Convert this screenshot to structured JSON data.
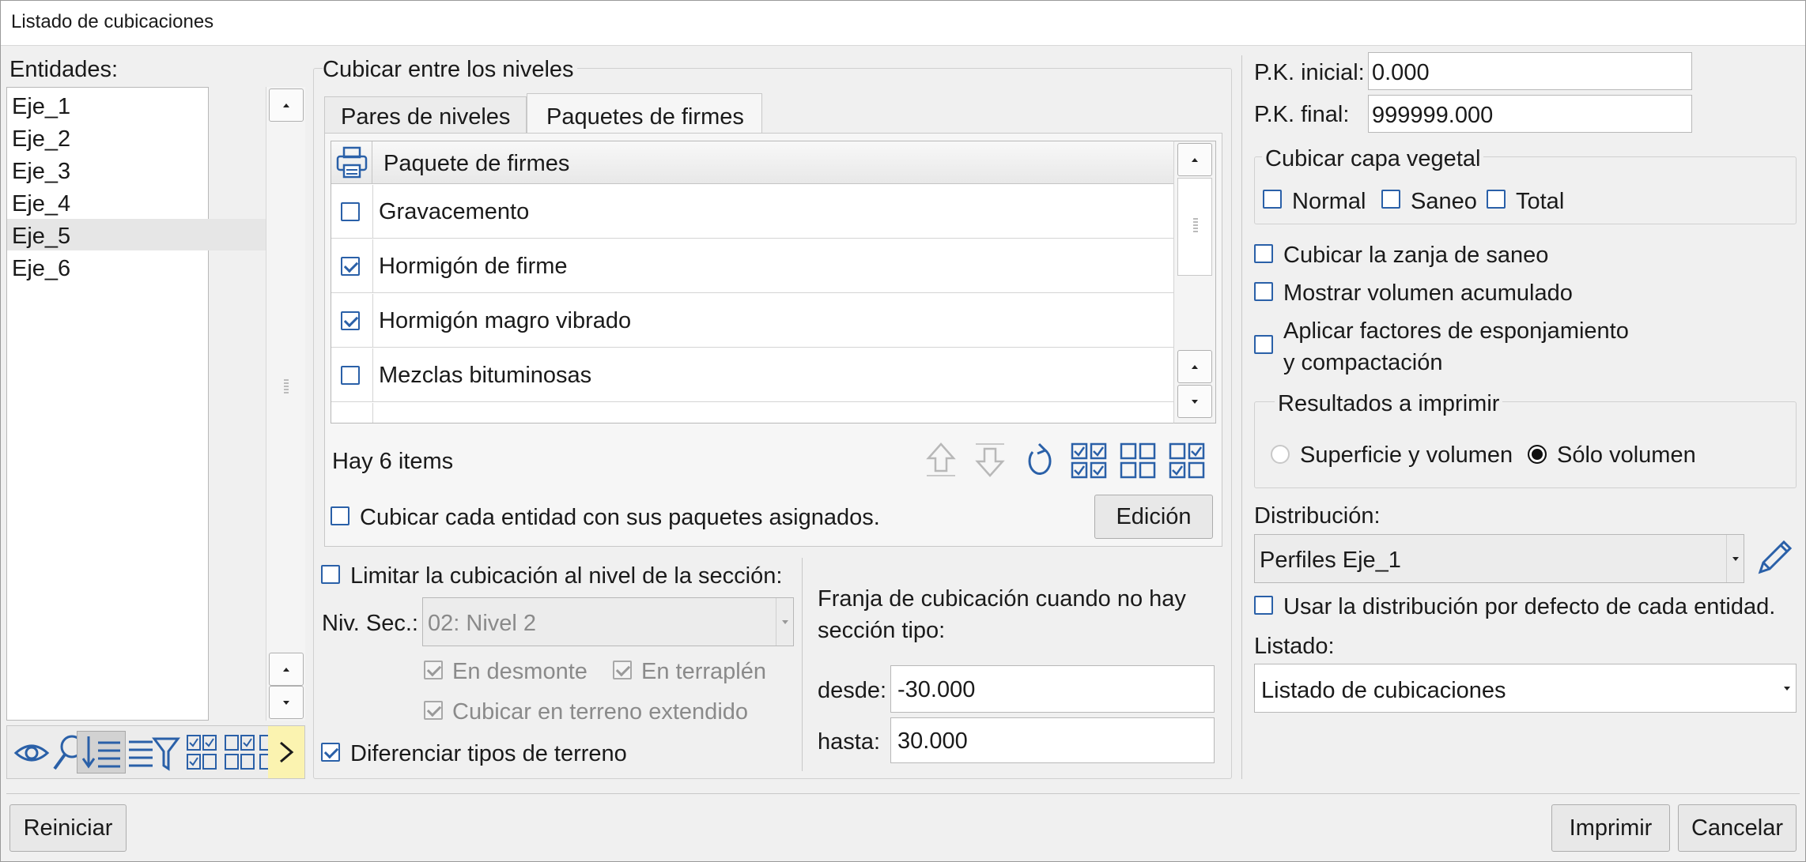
{
  "window": {
    "title": "Listado de cubicaciones"
  },
  "entities": {
    "label": "Entidades:",
    "items": [
      "Eje_1",
      "Eje_2",
      "Eje_3",
      "Eje_4",
      "Eje_5",
      "Eje_6"
    ],
    "selected": "Eje_5",
    "toolbar_icons": [
      "eye-icon",
      "search-icon",
      "sort-icon",
      "filter-icon",
      "check-all-icon",
      "uncheck-all-icon",
      "invert-check-icon",
      "expand-arrow-icon"
    ]
  },
  "levels": {
    "group_title": "Cubicar entre los niveles",
    "tabs": [
      "Pares de niveles",
      "Paquetes de firmes"
    ],
    "active_tab": "Paquetes de firmes",
    "table_header": "Paquete de firmes",
    "rows": [
      {
        "label": "Gravacemento",
        "checked": false
      },
      {
        "label": "Hormigón de firme",
        "checked": true
      },
      {
        "label": "Hormigón magro vibrado",
        "checked": true
      },
      {
        "label": "Mezclas bituminosas",
        "checked": false
      }
    ],
    "count_text": "Hay 6 items",
    "assign_checkbox": "Cubicar cada entidad con sus paquetes asignados.",
    "edit_button": "Edición"
  },
  "section": {
    "limit_checkbox": "Limitar la cubicación al nivel de la sección:",
    "niv_label": "Niv. Sec.:",
    "niv_value": "02: Nivel 2",
    "desmonte": "En desmonte",
    "terraplen": "En terraplén",
    "extendido": "Cubicar en terreno extendido",
    "diferenciar": "Diferenciar tipos de terreno"
  },
  "franja": {
    "text_line1": "Franja de cubicación cuando no hay",
    "text_line2": "sección tipo:",
    "desde_label": "desde:",
    "desde_value": "-30.000",
    "hasta_label": "hasta:",
    "hasta_value": "30.000"
  },
  "right": {
    "pk_inicial_label": "P.K. inicial:",
    "pk_inicial_value": "0.000",
    "pk_final_label": "P.K. final:",
    "pk_final_value": "999999.000",
    "veg_title": "Cubicar capa vegetal",
    "veg_normal": "Normal",
    "veg_saneo": "Saneo",
    "veg_total": "Total",
    "zanja": "Cubicar la zanja de saneo",
    "acumulado": "Mostrar volumen acumulado",
    "factores_line1": "Aplicar factores de esponjamiento",
    "factores_line2": "y compactación",
    "resultados_title": "Resultados a imprimir",
    "res_opt1": "Superficie y volumen",
    "res_opt2": "Sólo volumen",
    "res_selected": "Sólo volumen",
    "distribucion_label": "Distribución:",
    "distribucion_value": "Perfiles Eje_1",
    "usar_defecto": "Usar la distribución por defecto de cada entidad.",
    "listado_label": "Listado:",
    "listado_value": "Listado de cubicaciones"
  },
  "footer": {
    "reset": "Reiniciar",
    "print": "Imprimir",
    "cancel": "Cancelar"
  },
  "colors": {
    "accent": "#2a60a8",
    "selected_row": "#e6e6e6",
    "highlight_btn": "#fbf3b0"
  }
}
